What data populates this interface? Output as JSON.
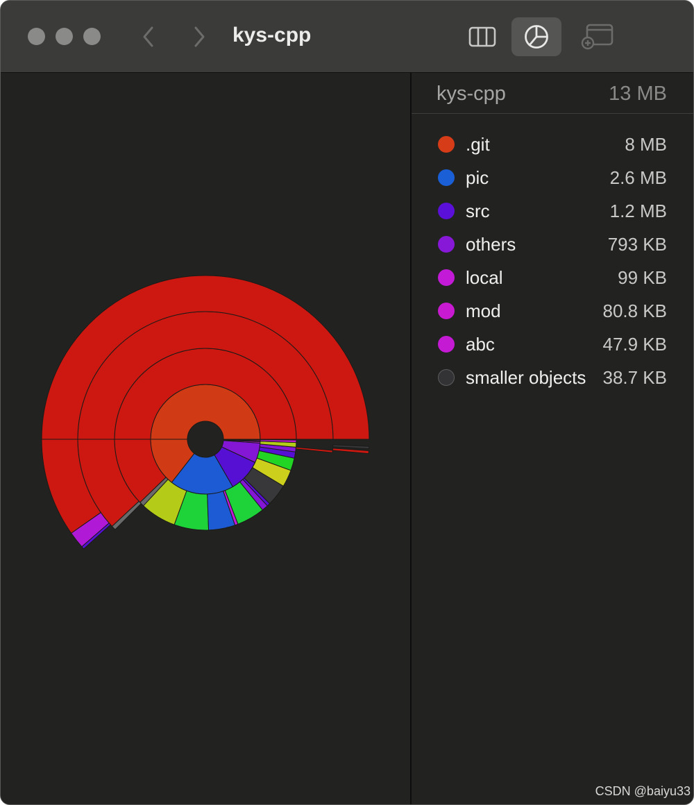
{
  "window": {
    "title": "kys-cpp"
  },
  "toolbar": {
    "back_icon": "chevron-left-icon",
    "forward_icon": "chevron-right-icon",
    "buttons": [
      {
        "icon": "columns-view-icon",
        "active": false
      },
      {
        "icon": "pie-chart-icon",
        "active": true
      },
      {
        "icon": "new-window-icon",
        "active": false
      }
    ]
  },
  "sidebar": {
    "folder_name": "kys-cpp",
    "total_size": "13 MB",
    "items": [
      {
        "name": ".git",
        "size": "8 MB",
        "color": "#d63c18"
      },
      {
        "name": "pic",
        "size": "2.6 MB",
        "color": "#1a5fd6"
      },
      {
        "name": "src",
        "size": "1.2 MB",
        "color": "#5a10d8"
      },
      {
        "name": "others",
        "size": "793 KB",
        "color": "#8818d8"
      },
      {
        "name": "local",
        "size": "99 KB",
        "color": "#c21ad6"
      },
      {
        "name": "mod",
        "size": "80.8 KB",
        "color": "#c81ad0"
      },
      {
        "name": "abc",
        "size": "47.9 KB",
        "color": "#c41ad4"
      },
      {
        "name": "smaller objects",
        "size": "38.7 KB",
        "color": "#333336"
      }
    ]
  },
  "watermark": "CSDN @baiyu33"
}
